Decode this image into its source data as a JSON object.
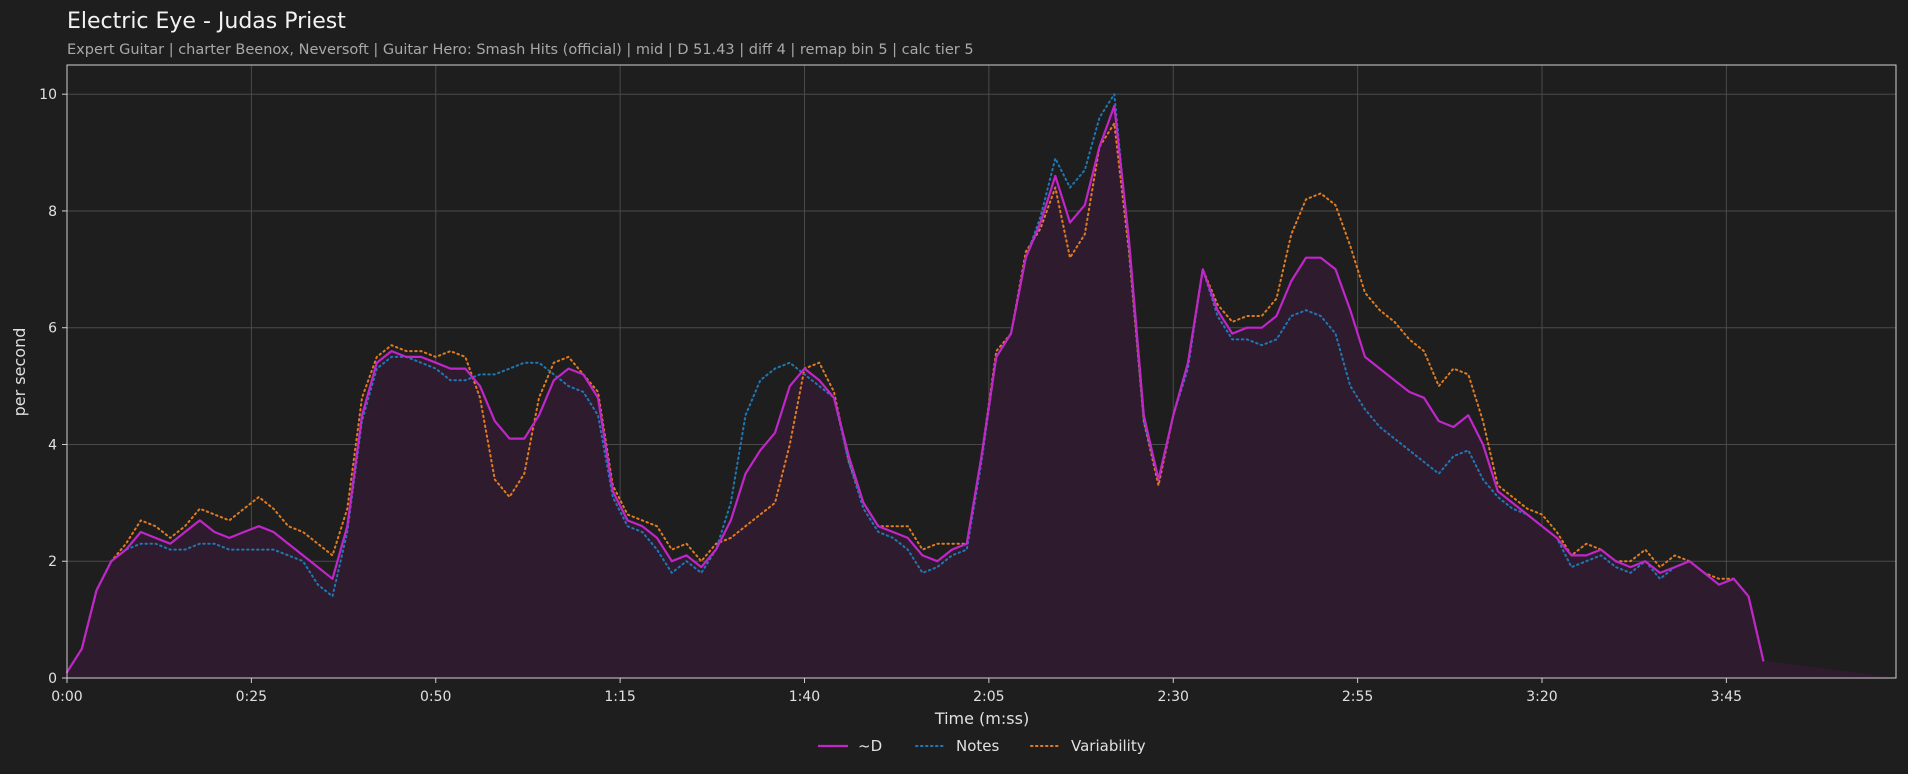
{
  "header": {
    "title": "Electric Eye - Judas Priest",
    "subtitle": "Expert Guitar  |  charter Beenox,  Neversoft  |  Guitar Hero: Smash Hits (official)  |  mid  |  D 51.43  |  diff 4  |  remap bin 5  |  calc tier 5"
  },
  "chart_data": {
    "type": "line",
    "title": "Electric Eye - Judas Priest",
    "xlabel": "Time (m:ss)",
    "ylabel": "per second",
    "xlim": [
      0,
      248
    ],
    "ylim": [
      0,
      10.5
    ],
    "x_ticks": [
      {
        "value": 0,
        "label": "0:00"
      },
      {
        "value": 25,
        "label": "0:25"
      },
      {
        "value": 50,
        "label": "0:50"
      },
      {
        "value": 75,
        "label": "1:15"
      },
      {
        "value": 100,
        "label": "1:40"
      },
      {
        "value": 125,
        "label": "2:05"
      },
      {
        "value": 150,
        "label": "2:30"
      },
      {
        "value": 175,
        "label": "2:55"
      },
      {
        "value": 200,
        "label": "3:20"
      },
      {
        "value": 225,
        "label": "3:45"
      }
    ],
    "y_ticks": [
      {
        "value": 0,
        "label": "0"
      },
      {
        "value": 2,
        "label": "2"
      },
      {
        "value": 4,
        "label": "4"
      },
      {
        "value": 6,
        "label": "6"
      },
      {
        "value": 8,
        "label": "8"
      },
      {
        "value": 10,
        "label": "10"
      }
    ],
    "grid": true,
    "legend_position": "bottom-center",
    "x": [
      0,
      2,
      4,
      6,
      8,
      10,
      12,
      14,
      16,
      18,
      20,
      22,
      24,
      26,
      28,
      30,
      32,
      34,
      36,
      38,
      40,
      42,
      44,
      46,
      48,
      50,
      52,
      54,
      56,
      58,
      60,
      62,
      64,
      66,
      68,
      70,
      72,
      74,
      76,
      78,
      80,
      82,
      84,
      86,
      88,
      90,
      92,
      94,
      96,
      98,
      100,
      102,
      104,
      106,
      108,
      110,
      112,
      114,
      116,
      118,
      120,
      122,
      124,
      126,
      128,
      130,
      132,
      134,
      136,
      138,
      140,
      142,
      144,
      146,
      148,
      150,
      152,
      154,
      156,
      158,
      160,
      162,
      164,
      166,
      168,
      170,
      172,
      174,
      176,
      178,
      180,
      182,
      184,
      186,
      188,
      190,
      192,
      194,
      196,
      198,
      200,
      202,
      204,
      206,
      208,
      210,
      212,
      214,
      216,
      218,
      220,
      222,
      224,
      226,
      228,
      230,
      232,
      234,
      236,
      238,
      240,
      242,
      244,
      246,
      248
    ],
    "series": [
      {
        "name": "~D",
        "color": "#c026c8",
        "style": "solid",
        "fill": "#2e1c2e",
        "values": [
          0.1,
          0.5,
          1.5,
          2.0,
          2.2,
          2.5,
          2.4,
          2.3,
          2.5,
          2.7,
          2.5,
          2.4,
          2.5,
          2.6,
          2.5,
          2.3,
          2.1,
          1.9,
          1.7,
          2.6,
          4.5,
          5.4,
          5.6,
          5.5,
          5.5,
          5.4,
          5.3,
          5.3,
          5.0,
          4.4,
          4.1,
          4.1,
          4.5,
          5.1,
          5.3,
          5.2,
          4.8,
          3.2,
          2.7,
          2.6,
          2.4,
          2.0,
          2.1,
          1.9,
          2.2,
          2.7,
          3.5,
          3.9,
          4.2,
          5.0,
          5.3,
          5.1,
          4.8,
          3.8,
          3.0,
          2.6,
          2.5,
          2.4,
          2.1,
          2.0,
          2.2,
          2.3,
          3.8,
          5.5,
          5.9,
          7.2,
          7.8,
          8.6,
          7.8,
          8.1,
          9.1,
          9.8,
          7.5,
          4.5,
          3.4,
          4.5,
          5.4,
          7.0,
          6.3,
          5.9,
          6.0,
          6.0,
          6.2,
          6.8,
          7.2,
          7.2,
          7.0,
          6.3,
          5.5,
          5.3,
          5.1,
          4.9,
          4.8,
          4.4,
          4.3,
          4.5,
          4.0,
          3.2,
          3.0,
          2.8,
          2.6,
          2.4,
          2.1,
          2.1,
          2.2,
          2.0,
          1.9,
          2.0,
          1.8,
          1.9,
          2.0,
          1.8,
          1.6,
          1.7,
          1.4,
          0.3
        ]
      },
      {
        "name": "Notes",
        "color": "#1f77b4",
        "style": "dotted",
        "values": [
          0.1,
          0.5,
          1.5,
          2.0,
          2.2,
          2.3,
          2.3,
          2.2,
          2.2,
          2.3,
          2.3,
          2.2,
          2.2,
          2.2,
          2.2,
          2.1,
          2.0,
          1.6,
          1.4,
          2.5,
          4.4,
          5.3,
          5.5,
          5.5,
          5.4,
          5.3,
          5.1,
          5.1,
          5.2,
          5.2,
          5.3,
          5.4,
          5.4,
          5.2,
          5.0,
          4.9,
          4.5,
          3.1,
          2.6,
          2.5,
          2.2,
          1.8,
          2.0,
          1.8,
          2.2,
          3.0,
          4.5,
          5.1,
          5.3,
          5.4,
          5.2,
          5.0,
          4.8,
          3.7,
          2.9,
          2.5,
          2.4,
          2.2,
          1.8,
          1.9,
          2.1,
          2.2,
          3.7,
          5.5,
          5.9,
          7.2,
          7.9,
          8.9,
          8.4,
          8.7,
          9.6,
          10.0,
          7.4,
          4.4,
          3.4,
          4.5,
          5.3,
          7.0,
          6.2,
          5.8,
          5.8,
          5.7,
          5.8,
          6.2,
          6.3,
          6.2,
          5.9,
          5.0,
          4.6,
          4.3,
          4.1,
          3.9,
          3.7,
          3.5,
          3.8,
          3.9,
          3.4,
          3.1,
          2.9,
          2.8,
          2.6,
          2.4,
          1.9,
          2.0,
          2.1,
          1.9,
          1.8,
          2.0,
          1.7,
          1.9,
          2.0,
          1.8,
          1.6,
          1.7,
          1.4,
          0.3
        ]
      },
      {
        "name": "Variability",
        "color": "#e07b22",
        "style": "dotted",
        "values": [
          0.1,
          0.5,
          1.5,
          2.0,
          2.3,
          2.7,
          2.6,
          2.4,
          2.6,
          2.9,
          2.8,
          2.7,
          2.9,
          3.1,
          2.9,
          2.6,
          2.5,
          2.3,
          2.1,
          2.9,
          4.8,
          5.5,
          5.7,
          5.6,
          5.6,
          5.5,
          5.6,
          5.5,
          4.8,
          3.4,
          3.1,
          3.5,
          4.8,
          5.4,
          5.5,
          5.2,
          4.9,
          3.3,
          2.8,
          2.7,
          2.6,
          2.2,
          2.3,
          2.0,
          2.3,
          2.4,
          2.6,
          2.8,
          3.0,
          4.0,
          5.3,
          5.4,
          4.9,
          3.7,
          3.0,
          2.6,
          2.6,
          2.6,
          2.2,
          2.3,
          2.3,
          2.3,
          3.8,
          5.6,
          5.9,
          7.3,
          7.7,
          8.4,
          7.2,
          7.6,
          9.1,
          9.5,
          7.3,
          4.4,
          3.3,
          4.5,
          5.4,
          7.0,
          6.4,
          6.1,
          6.2,
          6.2,
          6.5,
          7.6,
          8.2,
          8.3,
          8.1,
          7.4,
          6.6,
          6.3,
          6.1,
          5.8,
          5.6,
          5.0,
          5.3,
          5.2,
          4.4,
          3.3,
          3.1,
          2.9,
          2.8,
          2.5,
          2.1,
          2.3,
          2.2,
          2.0,
          2.0,
          2.2,
          1.9,
          2.1,
          2.0,
          1.8,
          1.7,
          1.7,
          1.4,
          0.3
        ]
      }
    ]
  }
}
